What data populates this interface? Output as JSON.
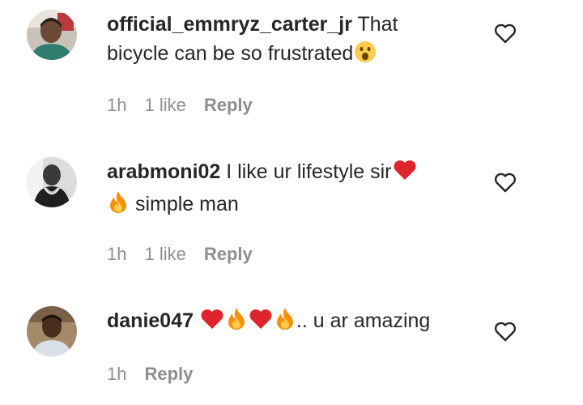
{
  "comments": [
    {
      "username": "official_emmryz_carter_jr",
      "text_line1": " That",
      "text_line2": "bicycle can be so frustrated",
      "time": "1h",
      "likes": "1 like",
      "reply_label": "Reply",
      "emojis": [
        "astonished-face"
      ],
      "avatar_icon": "user-avatar"
    },
    {
      "username": "arabmoni02",
      "text_line1": " I like ur lifestyle sir",
      "text_line2": " simple man",
      "time": "1h",
      "likes": "1 like",
      "reply_label": "Reply",
      "emojis": [
        "red-heart",
        "fire"
      ],
      "avatar_icon": "user-avatar"
    },
    {
      "username": "danie047",
      "text_tail": ".. u ar amazing",
      "time": "1h",
      "reply_label": "Reply",
      "emojis": [
        "red-heart",
        "fire",
        "red-heart",
        "fire"
      ],
      "avatar_icon": "user-avatar"
    }
  ],
  "icons": {
    "like": "heart-outline-icon"
  },
  "colors": {
    "text": "#262626",
    "meta": "#8e8e8e",
    "heart": "#e0242b",
    "fire": "#f4900c"
  }
}
